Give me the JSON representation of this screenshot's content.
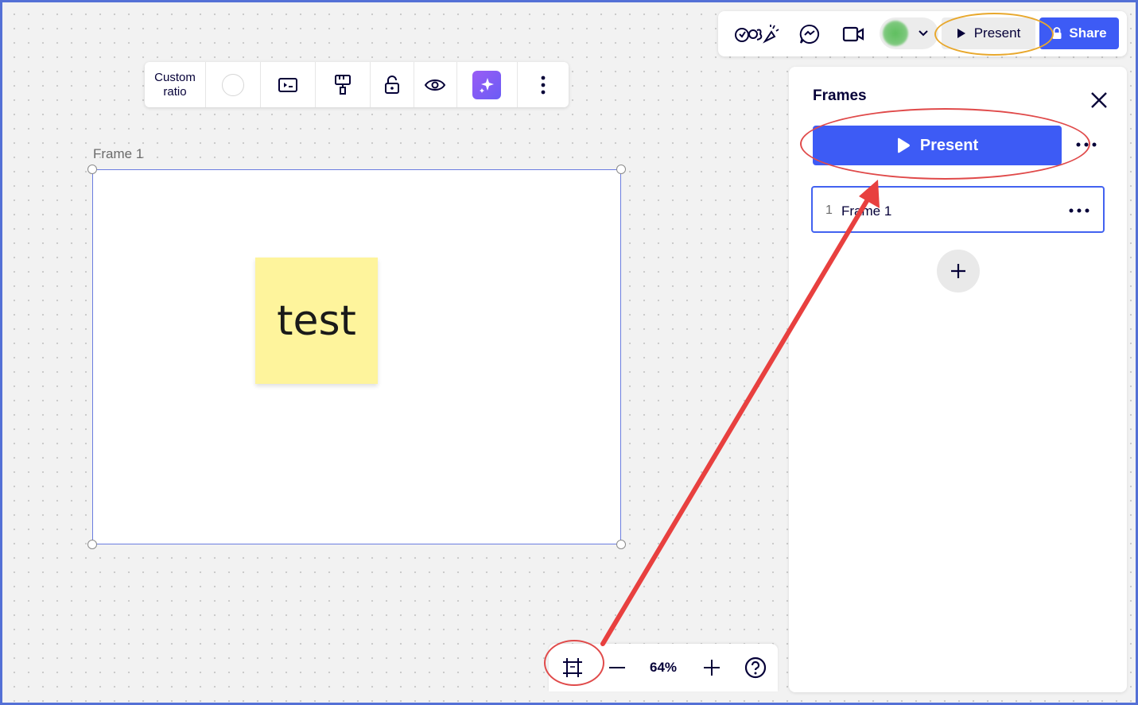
{
  "top_bar": {
    "reactions_icon": "reactions-icon",
    "chat_icon": "chat-icon",
    "video_icon": "video-camera-icon",
    "present_label": "Present",
    "share_label": "Share"
  },
  "frame_toolbar": {
    "ratio_line1": "Custom",
    "ratio_line2": "ratio",
    "icons": [
      "color-circle-icon",
      "slideshow-icon",
      "paint-roller-icon",
      "unlock-icon",
      "eye-icon",
      "ai-sparkle-icon",
      "more-vertical-icon"
    ]
  },
  "canvas": {
    "frame_title": "Frame 1",
    "sticky_text": "test"
  },
  "frames_panel": {
    "title": "Frames",
    "present_label": "Present",
    "items": [
      {
        "number": "1",
        "name": "Frame 1"
      }
    ]
  },
  "zoom_bar": {
    "zoom_level": "64%"
  },
  "colors": {
    "accent_blue": "#3d5bf5",
    "annotation_red": "#e04a4a",
    "annotation_orange": "#e8a82d",
    "sticky_yellow": "#fef49c"
  }
}
